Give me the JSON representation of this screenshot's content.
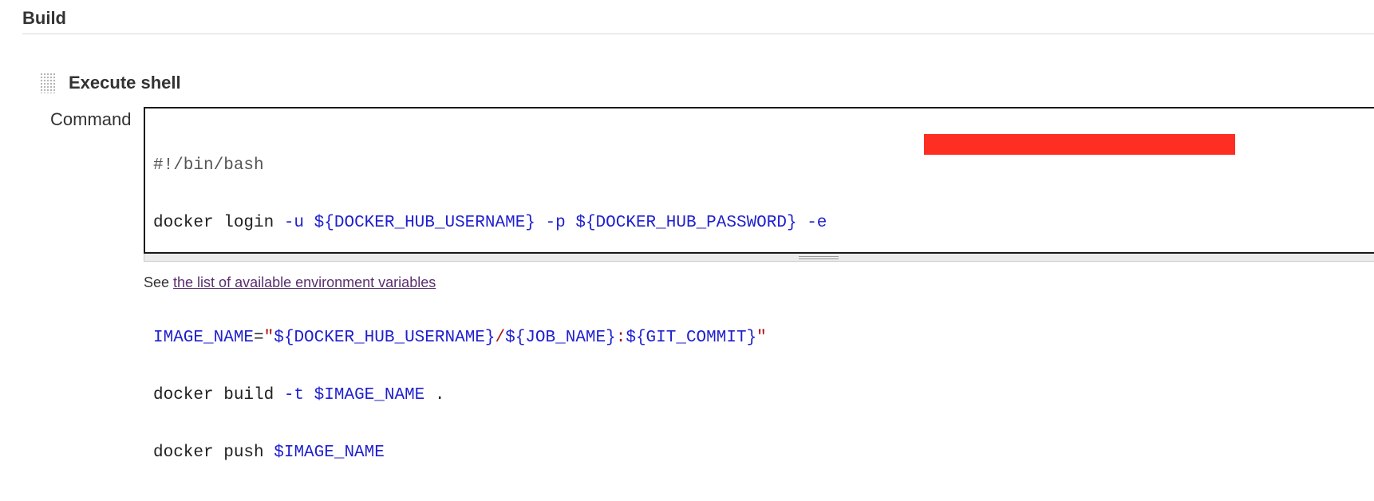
{
  "section": {
    "title": "Build"
  },
  "step": {
    "title": "Execute shell",
    "handle_icon": "drag-handle-icon"
  },
  "command": {
    "label": "Command",
    "lines": {
      "l1": "#!/bin/bash",
      "l2_cmd": "docker login ",
      "l2_u": "-u",
      "l2_sp1": " ",
      "l2_user": "${DOCKER_HUB_USERNAME}",
      "l2_sp2": " ",
      "l2_p": "-p",
      "l2_sp3": " ",
      "l2_pass": "${DOCKER_HUB_PASSWORD}",
      "l2_sp4": " ",
      "l2_e": "-e",
      "l4_var": "IMAGE_NAME",
      "l4_eq": "=",
      "l4_q1": "\"",
      "l4_user": "${DOCKER_HUB_USERNAME}",
      "l4_slash": "/",
      "l4_job": "${JOB_NAME}",
      "l4_colon": ":",
      "l4_commit": "${GIT_COMMIT}",
      "l4_q2": "\"",
      "l5_cmd": "docker build ",
      "l5_t": "-t",
      "l5_sp": " ",
      "l5_img": "$IMAGE_NAME",
      "l5_dot": " .",
      "l6_cmd": "docker push ",
      "l6_img": "$IMAGE_NAME"
    },
    "redaction_color": "#fe2e23"
  },
  "help": {
    "prefix": "See ",
    "link_text": "the list of available environment variables"
  }
}
